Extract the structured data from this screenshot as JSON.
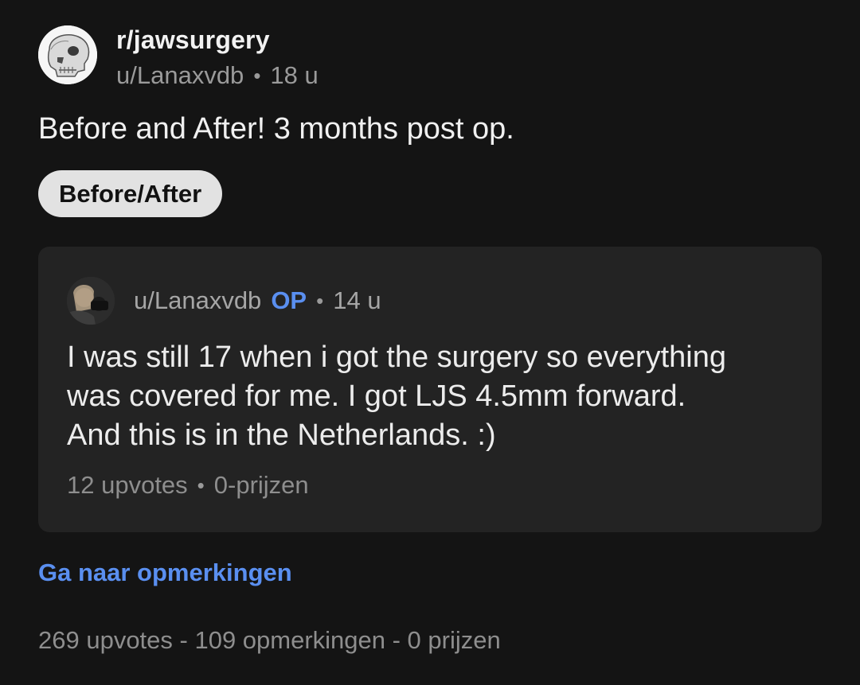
{
  "post": {
    "subreddit": "r/jawsurgery",
    "author": "u/Lanaxvdb",
    "age": "18 u",
    "separator": "•",
    "title": "Before and After! 3 months post op.",
    "flair": "Before/After",
    "avatar_icon": "skull-icon"
  },
  "comment": {
    "author": "u/Lanaxvdb",
    "op_label": "OP",
    "age": "14 u",
    "separator": "•",
    "lines": [
      "I was still 17 when i got the surgery so everything",
      "was covered for me. I got LJS 4.5mm forward.",
      "And this is in the Netherlands. :)"
    ],
    "upvotes": "12 upvotes",
    "awards": "0-prijzen"
  },
  "links": {
    "goto_comments": "Ga naar opmerkingen"
  },
  "stats": {
    "summary": "269 upvotes - 109 opmerkingen - 0 prijzen"
  },
  "colors": {
    "background": "#141414",
    "card": "#232323",
    "accent_blue": "#5a8ff0",
    "flair_bg": "#e2e2e2"
  }
}
